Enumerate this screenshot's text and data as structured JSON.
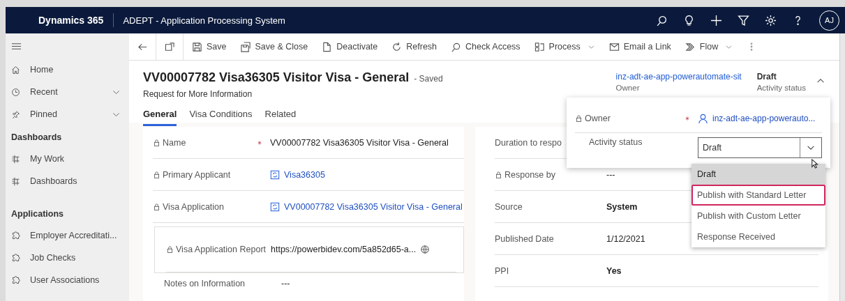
{
  "app_bar": {
    "brand": "Dynamics 365",
    "app_name": "ADEPT - Application Processing System",
    "avatar_initials": "AJ"
  },
  "sidebar": {
    "items": [
      {
        "label": "Home",
        "expandable": false
      },
      {
        "label": "Recent",
        "expandable": true
      },
      {
        "label": "Pinned",
        "expandable": true
      }
    ],
    "groups": [
      {
        "heading": "Dashboards",
        "items": [
          {
            "label": "My Work"
          },
          {
            "label": "Dashboards"
          }
        ]
      },
      {
        "heading": "Applications",
        "items": [
          {
            "label": "Employer Accreditati..."
          },
          {
            "label": "Job Checks"
          },
          {
            "label": "User Associations"
          }
        ]
      }
    ]
  },
  "command_bar": {
    "buttons": [
      {
        "label": "Save",
        "has_menu": false
      },
      {
        "label": "Save & Close",
        "has_menu": false
      },
      {
        "label": "Deactivate",
        "has_menu": false
      },
      {
        "label": "Refresh",
        "has_menu": false
      },
      {
        "label": "Check Access",
        "has_menu": false
      },
      {
        "label": "Process",
        "has_menu": true
      },
      {
        "label": "Email a Link",
        "has_menu": false
      },
      {
        "label": "Flow",
        "has_menu": true
      }
    ]
  },
  "header": {
    "title": "VV00007782 Visa36305 Visitor Visa - General",
    "save_status": "- Saved",
    "subtitle": "Request for More Information",
    "expanded": true,
    "fields": [
      {
        "value": "inz-adt-ae-app-powerautomate-sit",
        "label": "Owner",
        "kind": "link"
      },
      {
        "value": "Draft",
        "label": "Activity status",
        "kind": "bold"
      }
    ]
  },
  "tabs": [
    {
      "label": "General",
      "selected": true
    },
    {
      "label": "Visa Conditions",
      "selected": false
    },
    {
      "label": "Related",
      "selected": false
    }
  ],
  "left_fields": [
    {
      "label": "Name",
      "locked": true,
      "required": true,
      "value": "VV00007782 Visa36305 Visitor Visa - General",
      "kind": "text"
    },
    {
      "label": "Primary Applicant",
      "locked": true,
      "required": false,
      "value": "Visa36305",
      "kind": "lookup"
    },
    {
      "label": "Visa Application",
      "locked": true,
      "required": false,
      "value": "VV00007782 Visa36305 Visitor Visa - General",
      "kind": "lookup"
    },
    {
      "label": "Visa Application Report",
      "locked": true,
      "required": false,
      "value": "https://powerbidev.com/5a852d65-a...",
      "kind": "url"
    },
    {
      "label": "Notes on Information",
      "locked": false,
      "required": false,
      "value": "---",
      "kind": "text"
    }
  ],
  "right_fields": [
    {
      "label": "Duration to respo",
      "locked": false
    },
    {
      "label": "Response by",
      "locked": true,
      "value": "---",
      "kind": "text"
    },
    {
      "label": "Source",
      "locked": false,
      "value": "System",
      "kind": "bold"
    },
    {
      "label": "Published Date",
      "locked": false,
      "value": "1/12/2021",
      "kind": "date"
    },
    {
      "label": "PPI",
      "locked": false,
      "value": "Yes",
      "kind": "bold"
    }
  ],
  "flyout": {
    "owner": {
      "label": "Owner",
      "locked": true,
      "required": true,
      "value": "inz-adt-ae-app-powerauto..."
    },
    "status": {
      "label": "Activity status",
      "value": "Draft",
      "open": true,
      "options": [
        {
          "label": "Draft",
          "selected": true,
          "focused": false
        },
        {
          "label": "Publish with Standard Letter",
          "selected": false,
          "focused": true
        },
        {
          "label": "Publish with Custom Letter",
          "selected": false,
          "focused": false
        },
        {
          "label": "Response Received",
          "selected": false,
          "focused": false
        }
      ]
    }
  }
}
